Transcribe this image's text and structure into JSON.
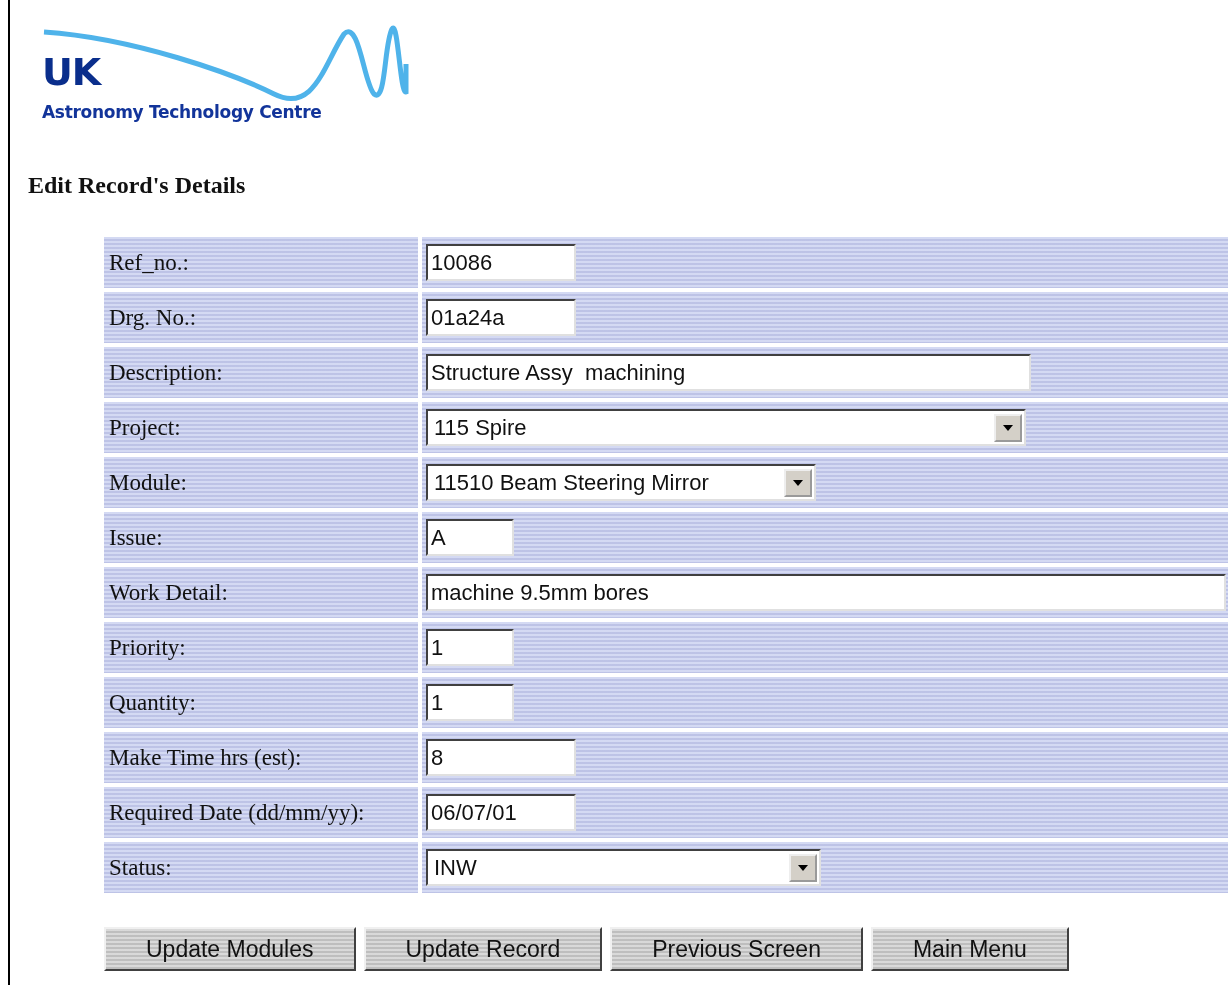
{
  "logo": {
    "mark": "UK",
    "name": "Astronomy Technology Centre"
  },
  "heading": "Edit Record's Details",
  "fields": [
    {
      "label": "Ref_no.:",
      "kind": "text",
      "value": "10086"
    },
    {
      "label": "Drg. No.:",
      "kind": "text",
      "value": "01a24a"
    },
    {
      "label": "Description:",
      "kind": "text",
      "value": "Structure Assy  machining"
    },
    {
      "label": "Project:",
      "kind": "select",
      "value": "115 Spire"
    },
    {
      "label": "Module:",
      "kind": "select",
      "value": "11510 Beam Steering Mirror"
    },
    {
      "label": "Issue:",
      "kind": "text",
      "value": "A"
    },
    {
      "label": "Work Detail:",
      "kind": "text",
      "value": "machine 9.5mm bores"
    },
    {
      "label": "Priority:",
      "kind": "text",
      "value": "1"
    },
    {
      "label": "Quantity:",
      "kind": "text",
      "value": "1"
    },
    {
      "label": "Make Time hrs (est):",
      "kind": "text",
      "value": "8"
    },
    {
      "label": "Required Date (dd/mm/yy):",
      "kind": "text",
      "value": "06/07/01"
    },
    {
      "label": "Status:",
      "kind": "select",
      "value": "INW"
    }
  ],
  "buttons": [
    "Update Modules",
    "Update Record",
    "Previous Screen",
    "Main Menu"
  ]
}
